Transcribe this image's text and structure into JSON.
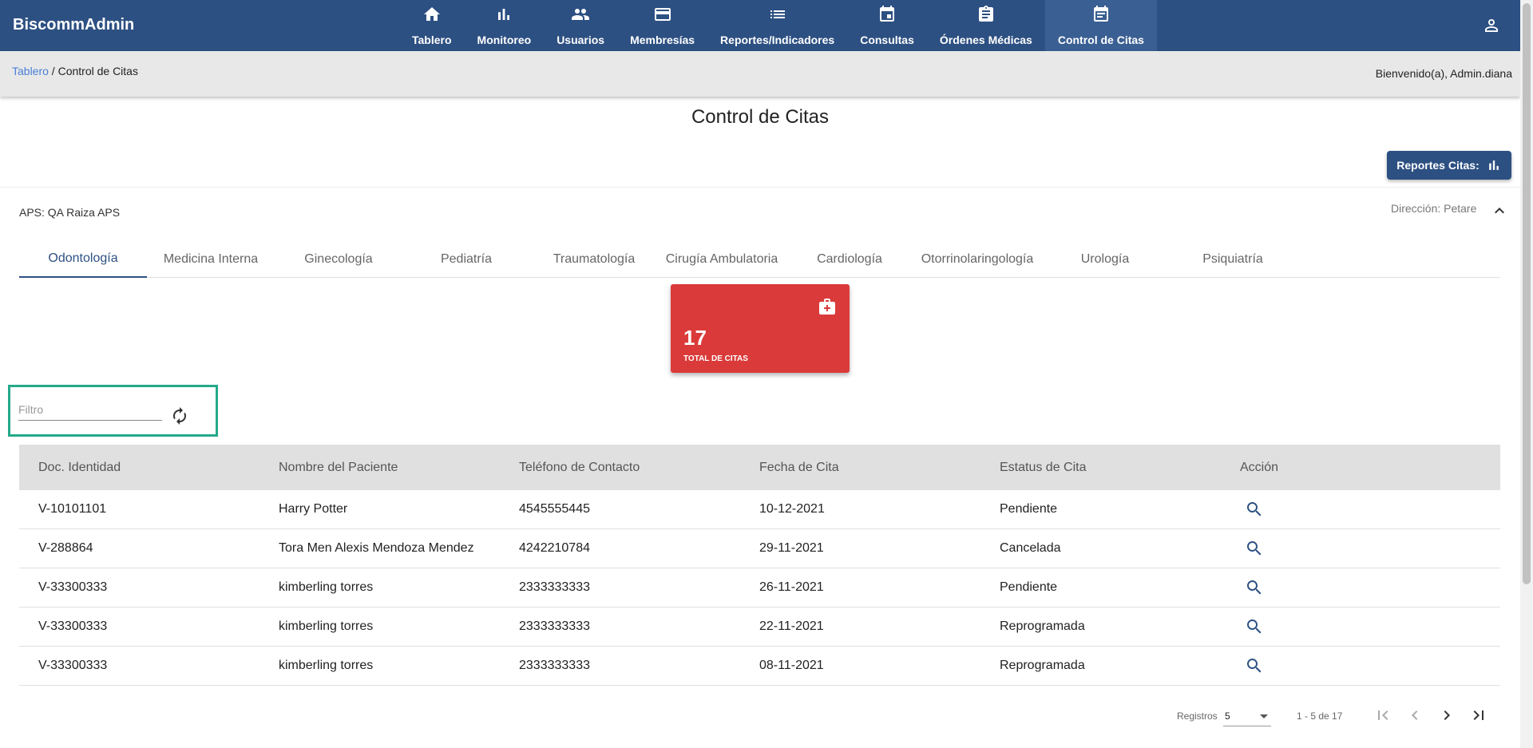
{
  "app": {
    "brand": "BiscommAdmin"
  },
  "nav": {
    "items": [
      {
        "label": "Tablero",
        "icon": "home-icon"
      },
      {
        "label": "Monitoreo",
        "icon": "bar-chart-icon"
      },
      {
        "label": "Usuarios",
        "icon": "people-icon"
      },
      {
        "label": "Membresías",
        "icon": "credit-card-icon"
      },
      {
        "label": "Reportes/Indicadores",
        "icon": "list-icon"
      },
      {
        "label": "Consultas",
        "icon": "calendar-icon"
      },
      {
        "label": "Órdenes Médicas",
        "icon": "clipboard-icon"
      },
      {
        "label": "Control de Citas",
        "icon": "calendar-icon",
        "active": true
      }
    ]
  },
  "header": {
    "breadcrumb": {
      "root": "Tablero",
      "separator": " / ",
      "current": "Control de Citas"
    },
    "welcome": "Bienvenido(a), Admin.diana"
  },
  "page": {
    "title": "Control de Citas",
    "report_button": "Reportes Citas:",
    "aps": "APS: QA Raiza APS",
    "direccion": "Dirección: Petare"
  },
  "tabs": [
    "Odontología",
    "Medicina Interna",
    "Ginecología",
    "Pediatría",
    "Traumatología",
    "Cirugía Ambulatoria",
    "Cardiología",
    "Otorrinolaringología",
    "Urología",
    "Psiquiatría"
  ],
  "stat": {
    "value": "17",
    "label": "TOTAL DE CITAS",
    "icon": "medical-kit-icon",
    "color": "#db3a3a"
  },
  "filter": {
    "placeholder": "Filtro",
    "value": ""
  },
  "table": {
    "headers": [
      "Doc. Identidad",
      "Nombre del Paciente",
      "Teléfono de Contacto",
      "Fecha de Cita",
      "Estatus de Cita",
      "Acción"
    ],
    "rows": [
      [
        "V-10101101",
        "Harry Potter",
        "4545555445",
        "10-12-2021",
        "Pendiente"
      ],
      [
        "V-288864",
        "Tora Men Alexis Mendoza Mendez",
        "4242210784",
        "29-11-2021",
        "Cancelada"
      ],
      [
        "V-33300333",
        "kimberling torres",
        "2333333333",
        "26-11-2021",
        "Pendiente"
      ],
      [
        "V-33300333",
        "kimberling torres",
        "2333333333",
        "22-11-2021",
        "Reprogramada"
      ],
      [
        "V-33300333",
        "kimberling torres",
        "2333333333",
        "08-11-2021",
        "Reprogramada"
      ]
    ]
  },
  "paginator": {
    "label": "Registros",
    "page_size": "5",
    "range": "1 - 5 de 17"
  },
  "colors": {
    "primary": "#2d5082",
    "accent_card": "#db3a3a",
    "filter_highlight": "#24a98a"
  }
}
